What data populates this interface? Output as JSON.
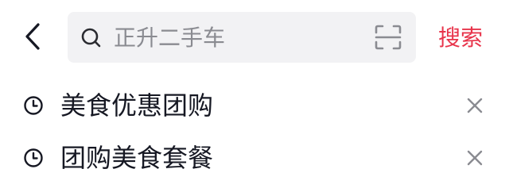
{
  "header": {
    "back_icon": "chevron-left-icon",
    "search": {
      "placeholder": "正升二手车",
      "value": "",
      "search_icon": "search-icon",
      "scan_icon": "scan-icon"
    },
    "search_button_label": "搜索"
  },
  "history": {
    "items": [
      {
        "text": "美食优惠团购",
        "icon": "clock-icon",
        "action_icon": "close-icon"
      },
      {
        "text": "团购美食套餐",
        "icon": "clock-icon",
        "action_icon": "close-icon"
      }
    ]
  },
  "colors": {
    "accent": "#e8344b",
    "search_bg": "#f2f2f4",
    "placeholder": "#8a8b91",
    "text": "#161823",
    "icon_gray": "#8a8b91"
  }
}
